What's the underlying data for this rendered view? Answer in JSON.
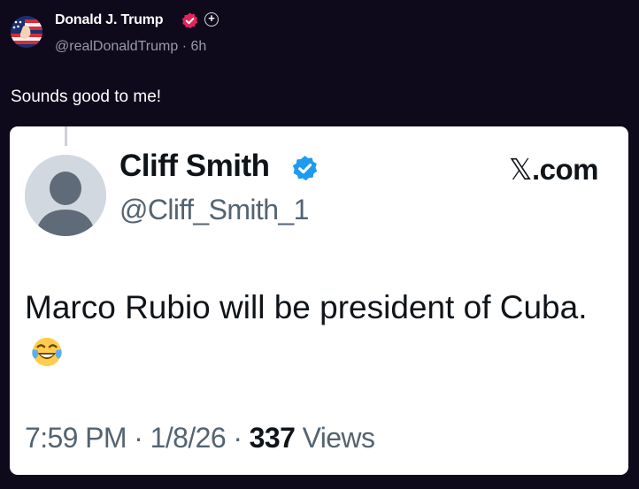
{
  "post": {
    "author_name": "Donald J. Trump",
    "plus_label": "+",
    "handle": "@realDonaldTrump",
    "separator": "·",
    "time_ago": "6h",
    "text": "Sounds good to me!",
    "icons": {
      "avatar": "flag-avatar",
      "verified": "verified-badge-icon",
      "plus": "plus-icon"
    },
    "colors": {
      "background": "#0e0a1c",
      "verified_badge": "#e1245a"
    }
  },
  "quoted": {
    "author_name": "Cliff Smith",
    "handle": "@Cliff_Smith_1",
    "source_glyph": "𝕏",
    "source_suffix": ".com",
    "text": "Marco Rubio will be president of Cuba.",
    "emoji": "face-with-tears-of-joy-emoji",
    "time": "7:59 PM",
    "separator": "·",
    "date": "1/8/26",
    "views_count": "337",
    "views_label": "Views",
    "icons": {
      "avatar": "default-avatar-icon",
      "verified": "verified-badge-icon"
    },
    "colors": {
      "verified_badge": "#1d9bf0",
      "text": "#0f1419",
      "muted": "#536471"
    }
  }
}
